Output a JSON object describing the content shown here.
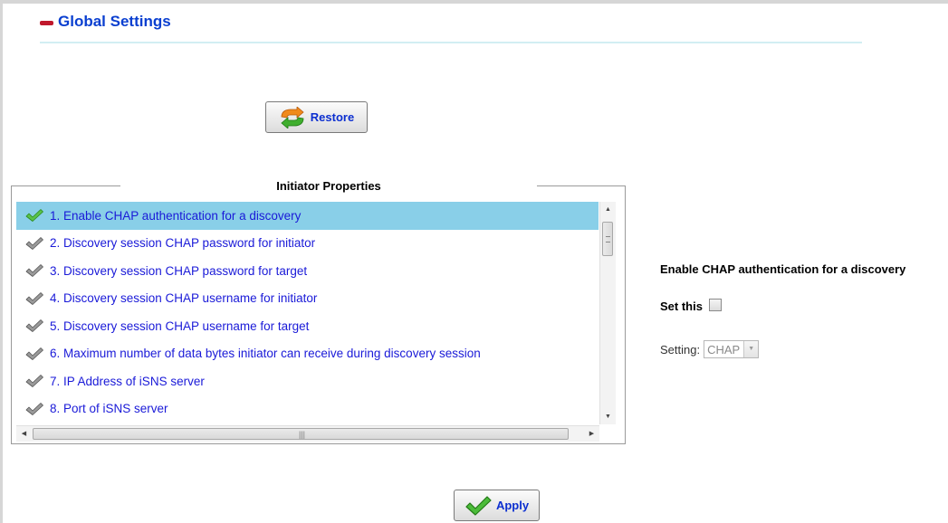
{
  "header": {
    "title": "Global Settings",
    "collapse_icon": "minus-icon",
    "accent_color": "#c0182c",
    "title_color": "#0a3fd0"
  },
  "toolbar": {
    "restore_label": "Restore",
    "restore_icon": "refresh-arrows-icon",
    "apply_label": "Apply",
    "apply_icon": "checkmark-icon"
  },
  "initiator_properties": {
    "legend": "Initiator Properties",
    "selected_index": 0,
    "selected_color": "#89cfe8",
    "items": [
      {
        "label": "1. Enable CHAP authentication for a discovery",
        "icon": "green-check-icon"
      },
      {
        "label": "2. Discovery session CHAP password for initiator",
        "icon": "gray-check-icon"
      },
      {
        "label": "3. Discovery session CHAP password for target",
        "icon": "gray-check-icon"
      },
      {
        "label": "4. Discovery session CHAP username for initiator",
        "icon": "gray-check-icon"
      },
      {
        "label": "5. Discovery session CHAP username for target",
        "icon": "gray-check-icon"
      },
      {
        "label": "6. Maximum number of data bytes initiator can receive during discovery session",
        "icon": "gray-check-icon"
      },
      {
        "label": "7. IP Address of iSNS server",
        "icon": "gray-check-icon"
      },
      {
        "label": "8. Port of iSNS server",
        "icon": "gray-check-icon"
      }
    ]
  },
  "detail": {
    "title": "Enable CHAP authentication for a discovery",
    "set_this_label": "Set this",
    "set_this_checked": false,
    "setting_label": "Setting:",
    "setting_value": "CHAP"
  }
}
